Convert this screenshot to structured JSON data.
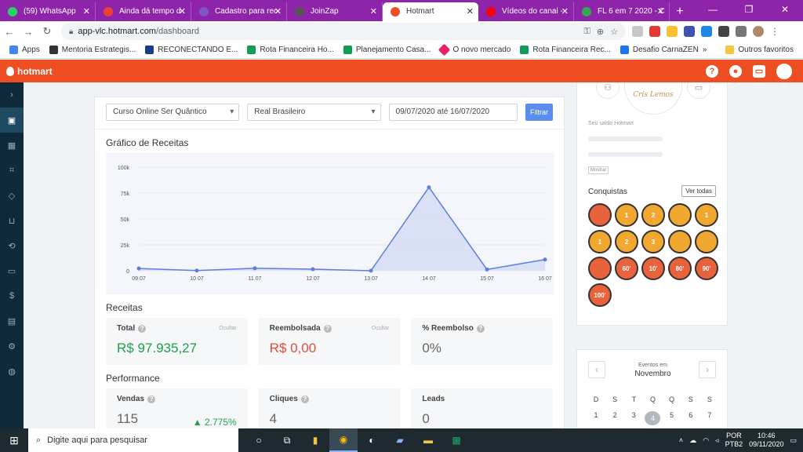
{
  "browser": {
    "tabs": [
      {
        "label": "(59) WhatsApp",
        "color": "#25d366"
      },
      {
        "label": "Ainda dá tempo d",
        "color": "#ea4335"
      },
      {
        "label": "Cadastro para rec",
        "color": "#7e57c2"
      },
      {
        "label": "JoinZap",
        "color": "#555555"
      },
      {
        "label": "Hotmart",
        "color": "#ef4e23"
      },
      {
        "label": "Vídeos do canal -",
        "color": "#ff0000"
      },
      {
        "label": "FL 6 em 7 2020 - C",
        "color": "#34a853"
      }
    ],
    "url_host": "app-vlc.hotmart.com",
    "url_path": "/dashboard",
    "bookmarks": [
      {
        "label": "Apps",
        "color": "#4285f4"
      },
      {
        "label": "Mentoria Estrategis...",
        "color": "#333333"
      },
      {
        "label": "RECONECTANDO E...",
        "color": "#1a3c8f"
      },
      {
        "label": "Rota Financeira Ho...",
        "color": "#0f9d58"
      },
      {
        "label": "Planejamento Casa...",
        "color": "#0f9d58"
      },
      {
        "label": "O novo mercado",
        "color": "#e91e63"
      },
      {
        "label": "Rota Financeira Rec...",
        "color": "#0f9d58"
      },
      {
        "label": "Desafio CarnaZEN",
        "color": "#1877f2"
      }
    ],
    "bookmarks_more": "»",
    "other_favorites": "Outros favoritos"
  },
  "hotmart": {
    "brand": "hotmart",
    "filters": {
      "product": "Curso Online Ser Quântico",
      "currency": "Real Brasileiro",
      "date_range": "09/07/2020 até 16/07/2020",
      "filter_button": "Filtrar"
    },
    "chart_title": "Gráfico de Receitas",
    "receitas_title": "Receitas",
    "receitas": [
      {
        "label": "Total",
        "value": "R$ 97.935,27",
        "hide": "Ocultar"
      },
      {
        "label": "Reembolsada",
        "value": "R$ 0,00",
        "hide": "Ocultar"
      },
      {
        "label": "% Reembolso",
        "value": "0%"
      }
    ],
    "performance_title": "Performance",
    "performance": [
      {
        "label": "Vendas",
        "value": "115",
        "growth": "2.775%"
      },
      {
        "label": "Cliques",
        "value": "4"
      },
      {
        "label": "Leads",
        "value": "0"
      }
    ],
    "side": {
      "logo_text": "Cris Lemos",
      "saldo_label": "Seu saldo Hotmart",
      "mostrar": "Mostrar",
      "conquistas": "Conquistas",
      "ver_todas": "Ver todas",
      "badges": [
        "",
        "1",
        "2",
        "",
        "1",
        "1",
        "2",
        "3",
        "",
        "",
        "",
        "60'",
        "10'",
        "80'",
        "90'",
        "100'"
      ]
    },
    "calendar": {
      "title": "Eventos em",
      "month": "Novembro",
      "weekdays": [
        "D",
        "S",
        "T",
        "Q",
        "Q",
        "S",
        "S"
      ],
      "days": [
        "1",
        "2",
        "3",
        "4",
        "5",
        "6",
        "7"
      ],
      "today": "4"
    }
  },
  "chart_data": {
    "type": "area",
    "categories": [
      "09 07",
      "10 07",
      "11 07",
      "12 07",
      "13 07",
      "14 07",
      "15 07",
      "16 07"
    ],
    "values": [
      2200,
      200,
      2400,
      1500,
      0,
      80500,
      1200,
      10800
    ],
    "yticks": [
      "100k",
      "75k",
      "50k",
      "25k",
      "0"
    ],
    "ylim": [
      0,
      100000
    ],
    "color": "#5b7fe0",
    "fill": "#c8d3f5"
  },
  "taskbar": {
    "search_placeholder": "Digite aqui para pesquisar",
    "lang": "POR",
    "lang2": "PTB2",
    "time": "10:46",
    "date": "09/11/2020"
  }
}
